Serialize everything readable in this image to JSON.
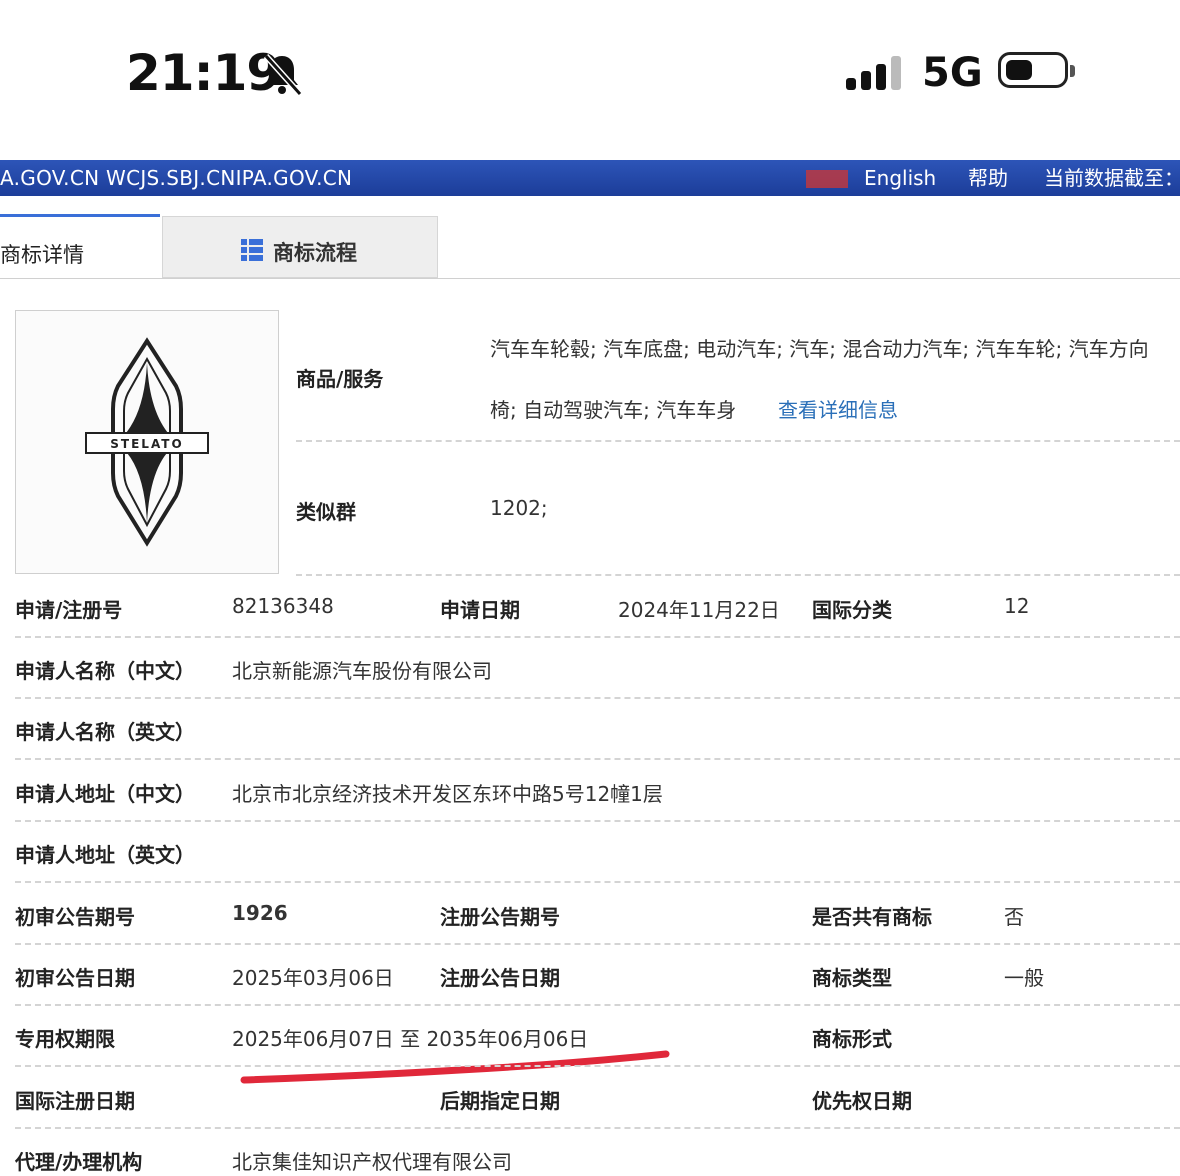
{
  "status_bar": {
    "time": "21:19",
    "network": "5G",
    "icons": [
      "bell-muted-icon",
      "signal-icon",
      "battery-icon"
    ]
  },
  "header": {
    "domains": "A.GOV.CN WCJS.SBJ.CNIPA.GOV.CN",
    "english": "English",
    "help": "帮助",
    "current_data": "当前数据截至："
  },
  "tabs": {
    "detail": "商标详情",
    "process": "商标流程"
  },
  "logo": {
    "text": "STELATO"
  },
  "goods": {
    "label": "商品/服务",
    "line1": "汽车车轮毂; 汽车底盘; 电动汽车; 汽车; 混合动力汽车; 汽车车轮; 汽车方向",
    "line2": "椅; 自动驾驶汽车; 汽车车身",
    "more_link": "查看详细信息"
  },
  "similar_group": {
    "label": "类似群",
    "value": "1202;"
  },
  "fields": {
    "reg_no_label": "申请/注册号",
    "reg_no": "82136348",
    "app_date_label": "申请日期",
    "app_date": "2024年11月22日",
    "intl_class_label": "国际分类",
    "intl_class": "12",
    "applicant_cn_label": "申请人名称（中文）",
    "applicant_cn": "北京新能源汽车股份有限公司",
    "applicant_en_label": "申请人名称（英文）",
    "address_cn_label": "申请人地址（中文）",
    "address_cn": "北京市北京经济技术开发区东环中路5号12幢1层",
    "address_en_label": "申请人地址（英文）",
    "prelim_issue_label": "初审公告期号",
    "prelim_issue": "1926",
    "reg_issue_label": "注册公告期号",
    "shared_label": "是否共有商标",
    "shared": "否",
    "prelim_date_label": "初审公告日期",
    "prelim_date": "2025年03月06日",
    "reg_date_label": "注册公告日期",
    "type_label": "商标类型",
    "type": "一般",
    "term_label": "专用权期限",
    "term": "2025年06月07日 至 2035年06月06日",
    "form_label": "商标形式",
    "intl_reg_date_label": "国际注册日期",
    "later_date_label": "后期指定日期",
    "priority_date_label": "优先权日期",
    "agent_label": "代理/办理机构",
    "agent": "北京集佳知识产权代理有限公司"
  },
  "colors": {
    "header_bar": "#1f43a3",
    "tab_accent": "#3a6fd8",
    "link": "#2a6fb8",
    "red_annotation": "#e0283a"
  }
}
